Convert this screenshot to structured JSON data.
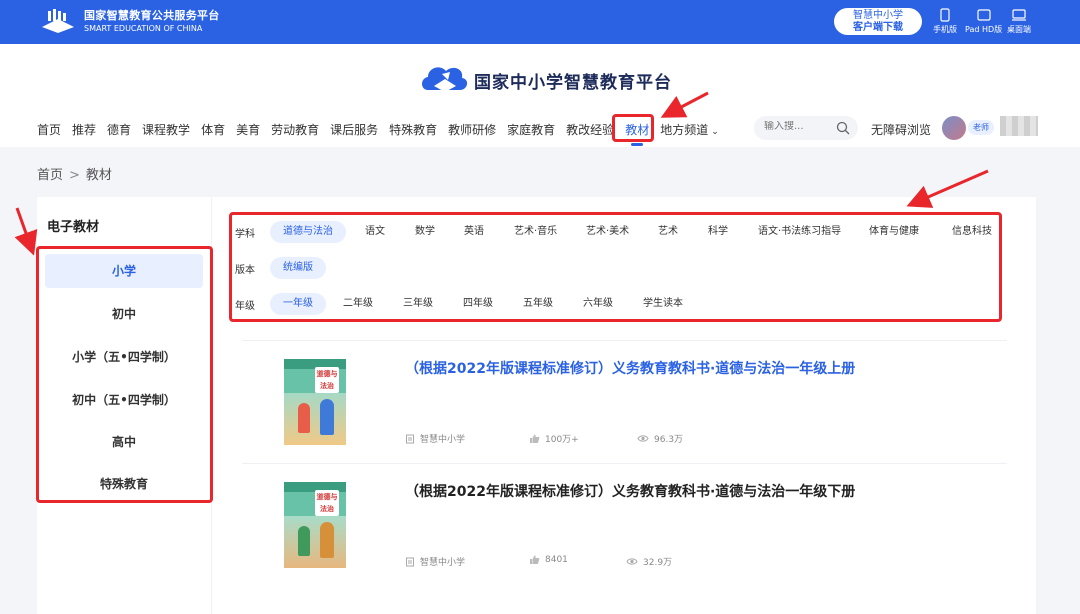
{
  "topbar": {
    "brand_cn": "国家智慧教育公共服务平台",
    "brand_en": "SMART EDUCATION OF CHINA",
    "download_line1": "智慧中小学",
    "download_line2": "客户端下载",
    "devices": [
      {
        "label": "手机版",
        "icon": "phone-icon"
      },
      {
        "label": "Pad HD版",
        "icon": "tablet-icon"
      },
      {
        "label": "桌面端",
        "icon": "desktop-icon"
      }
    ]
  },
  "header": {
    "site_title": "国家中小学智慧教育平台",
    "nav": [
      "首页",
      "推荐",
      "德育",
      "课程教学",
      "体育",
      "美育",
      "劳动教育",
      "课后服务",
      "特殊教育",
      "教师研修",
      "家庭教育",
      "教改经验",
      "教材",
      "地方频道"
    ],
    "nav_active": "教材",
    "search_placeholder": "输入搜...",
    "a11y_label": "无障碍浏览",
    "role_badge": "老师"
  },
  "breadcrumb": {
    "home": "首页",
    "separator": ">",
    "current": "教材"
  },
  "sidebar": {
    "title": "电子教材",
    "items": [
      "小学",
      "初中",
      "小学（五•四学制）",
      "初中（五•四学制）",
      "高中",
      "特殊教育"
    ],
    "active": "小学"
  },
  "filters": {
    "subject_label": "学科",
    "subjects": [
      "道德与法治",
      "语文",
      "数学",
      "英语",
      "艺术·音乐",
      "艺术·美术",
      "艺术",
      "科学",
      "语文·书法练习指导",
      "体育与健康",
      "信息科技"
    ],
    "subject_active": "道德与法治",
    "edition_label": "版本",
    "editions": [
      "统编版"
    ],
    "edition_active": "统编版",
    "grade_label": "年级",
    "grades": [
      "一年级",
      "二年级",
      "三年级",
      "四年级",
      "五年级",
      "六年级",
      "学生读本"
    ],
    "grade_active": "一年级"
  },
  "books": [
    {
      "title": "（根据2022年版课程标准修订）义务教育教科书·道德与法治一年级上册",
      "cover_title": "道德与法治",
      "publisher": "智慧中小学",
      "likes": "100万+",
      "views": "96.3万"
    },
    {
      "title": "（根据2022年版课程标准修订）义务教育教科书·道德与法治一年级下册",
      "cover_title": "道德与法治",
      "publisher": "智慧中小学",
      "likes": "8401",
      "views": "32.9万"
    }
  ],
  "colors": {
    "primary": "#2b62e3",
    "annotation": "#e8262b",
    "active_bg": "#e8efff"
  }
}
